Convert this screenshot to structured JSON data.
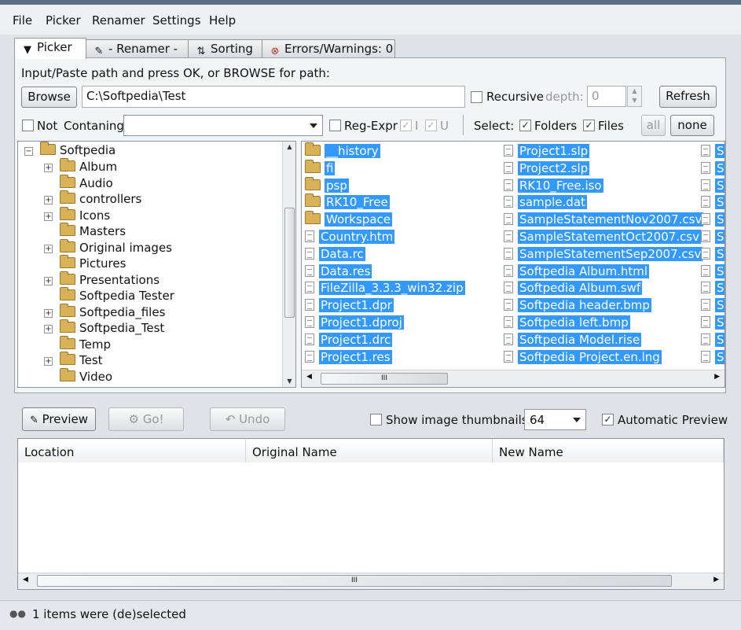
{
  "menu": [
    "File",
    "Picker",
    "Renamer",
    "Settings",
    "Help"
  ],
  "tabs": [
    {
      "label": "Picker",
      "icon": "funnel-icon"
    },
    {
      "label": "- Renamer -",
      "icon": "wand-icon"
    },
    {
      "label": "Sorting",
      "icon": "sort-icon"
    },
    {
      "label": "Errors/Warnings: 0",
      "icon": "error-icon"
    }
  ],
  "picker": {
    "instruction": "Input/Paste path and press OK, or BROWSE for path:",
    "browse_label": "Browse",
    "path_value": "C:\\Softpedia\\Test",
    "recursive_label": "Recursive",
    "depth_label": "depth:",
    "depth_value": "0",
    "refresh_label": "Refresh",
    "not_label": "Not",
    "containing_label": "Contaning:",
    "regexpr_label": "Reg-Expr",
    "i_label": "I",
    "u_label": "U",
    "select_label": "Select:",
    "folders_label": "Folders",
    "files_label": "Files",
    "all_label": "all",
    "none_label": "none"
  },
  "tree": {
    "root": "Softpedia",
    "items": [
      {
        "label": "Album",
        "expandable": true
      },
      {
        "label": "Audio",
        "expandable": false
      },
      {
        "label": "controllers",
        "expandable": true
      },
      {
        "label": "Icons",
        "expandable": true
      },
      {
        "label": "Masters",
        "expandable": false
      },
      {
        "label": "Original images",
        "expandable": true
      },
      {
        "label": "Pictures",
        "expandable": false
      },
      {
        "label": "Presentations",
        "expandable": true
      },
      {
        "label": "Softpedia Tester",
        "expandable": false
      },
      {
        "label": "Softpedia_files",
        "expandable": true
      },
      {
        "label": "Softpedia_Test",
        "expandable": true
      },
      {
        "label": "Temp",
        "expandable": false
      },
      {
        "label": "Test",
        "expandable": true
      },
      {
        "label": "Video",
        "expandable": false
      }
    ]
  },
  "files": {
    "col1": [
      {
        "label": "__history",
        "type": "folder"
      },
      {
        "label": "fi",
        "type": "folder"
      },
      {
        "label": "psp",
        "type": "folder"
      },
      {
        "label": "RK10_Free",
        "type": "folder"
      },
      {
        "label": "Workspace",
        "type": "folder"
      },
      {
        "label": "Country.htm",
        "type": "file"
      },
      {
        "label": "Data.rc",
        "type": "file"
      },
      {
        "label": "Data.res",
        "type": "file"
      },
      {
        "label": "FileZilla_3.3.3_win32.zip",
        "type": "file"
      },
      {
        "label": "Project1.dpr",
        "type": "file"
      },
      {
        "label": "Project1.dproj",
        "type": "file"
      },
      {
        "label": "Project1.drc",
        "type": "file"
      },
      {
        "label": "Project1.res",
        "type": "file"
      }
    ],
    "col2": [
      "Project1.slp",
      "Project2.slp",
      "RK10_Free.iso",
      "sample.dat",
      "SampleStatementNov2007.csv",
      "SampleStatementOct2007.csv",
      "SampleStatementSep2007.csv",
      "Softpedia Album.html",
      "Softpedia Album.swf",
      "Softpedia header.bmp",
      "Softpedia left.bmp",
      "Softpedia Model.rise",
      "Softpedia Project.en.lng"
    ],
    "col3": [
      "S",
      "S",
      "S",
      "S",
      "S",
      "S",
      "S",
      "S",
      "S",
      "S",
      "S",
      "S",
      "S"
    ],
    "hscroll_grip": "III"
  },
  "actions": {
    "preview_label": "Preview",
    "go_label": "Go!",
    "undo_label": "Undo",
    "thumbs_label": "Show image thumbnails",
    "thumb_size": "64",
    "auto_preview_label": "Automatic Preview"
  },
  "table": {
    "columns": [
      "Location",
      "Original Name",
      "New Name"
    ],
    "hscroll_grip": "III"
  },
  "status": {
    "text": "1 items were (de)selected"
  },
  "colors": {
    "selection": "#3399ff",
    "folder": "#d9b157"
  }
}
